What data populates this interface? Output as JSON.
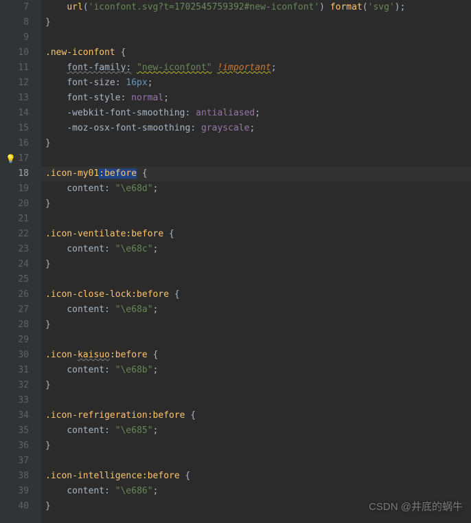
{
  "editor": {
    "startLine": 7,
    "activeLine": 18,
    "bulbLine": 17,
    "lines": [
      {
        "n": 7,
        "indent": 2,
        "tokens": [
          [
            "fn",
            "url"
          ],
          [
            "punc",
            "("
          ],
          [
            "str",
            "'iconfont.svg?t=1702545759392#new-iconfont'"
          ],
          [
            "punc",
            ") "
          ],
          [
            "fn",
            "format"
          ],
          [
            "punc",
            "("
          ],
          [
            "str",
            "'svg'"
          ],
          [
            "punc",
            ");"
          ]
        ]
      },
      {
        "n": 8,
        "indent": 1,
        "tokens": [
          [
            "brace",
            "}"
          ]
        ]
      },
      {
        "n": 9,
        "indent": 0,
        "tokens": []
      },
      {
        "n": 10,
        "indent": 1,
        "tokens": [
          [
            "sel",
            ".new-iconfont "
          ],
          [
            "brace",
            "{"
          ]
        ]
      },
      {
        "n": 11,
        "indent": 2,
        "tokens": [
          [
            "prop wavy",
            "font-family:"
          ],
          [
            "pl",
            " "
          ],
          [
            "str wavy2",
            "\"new-iconfont\""
          ],
          [
            "pl",
            " "
          ],
          [
            "imp wavy2",
            "!important"
          ],
          [
            "punc",
            ";"
          ]
        ]
      },
      {
        "n": 12,
        "indent": 2,
        "tokens": [
          [
            "prop",
            "font-size: "
          ],
          [
            "num",
            "16px"
          ],
          [
            "punc",
            ";"
          ]
        ]
      },
      {
        "n": 13,
        "indent": 2,
        "tokens": [
          [
            "prop",
            "font-style: "
          ],
          [
            "val",
            "normal"
          ],
          [
            "punc",
            ";"
          ]
        ]
      },
      {
        "n": 14,
        "indent": 2,
        "tokens": [
          [
            "prop",
            "-webkit-font-smoothing: "
          ],
          [
            "val",
            "antialiased"
          ],
          [
            "punc",
            ";"
          ]
        ]
      },
      {
        "n": 15,
        "indent": 2,
        "tokens": [
          [
            "prop",
            "-moz-osx-font-smoothing: "
          ],
          [
            "val",
            "grayscale"
          ],
          [
            "punc",
            ";"
          ]
        ]
      },
      {
        "n": 16,
        "indent": 1,
        "tokens": [
          [
            "brace",
            "}"
          ]
        ]
      },
      {
        "n": 17,
        "indent": 0,
        "tokens": []
      },
      {
        "n": 18,
        "indent": 1,
        "tokens": [
          [
            "sel",
            ".icon-my01"
          ],
          [
            "sel highlight",
            ":before"
          ],
          [
            "sel",
            " "
          ],
          [
            "brace",
            "{"
          ]
        ]
      },
      {
        "n": 19,
        "indent": 2,
        "tokens": [
          [
            "prop",
            "content: "
          ],
          [
            "str",
            "\"\\e68d\""
          ],
          [
            "punc",
            ";"
          ]
        ]
      },
      {
        "n": 20,
        "indent": 1,
        "tokens": [
          [
            "brace",
            "}"
          ]
        ]
      },
      {
        "n": 21,
        "indent": 0,
        "tokens": []
      },
      {
        "n": 22,
        "indent": 1,
        "tokens": [
          [
            "sel",
            ".icon-ventilate"
          ],
          [
            "sel",
            ":before "
          ],
          [
            "brace",
            "{"
          ]
        ]
      },
      {
        "n": 23,
        "indent": 2,
        "tokens": [
          [
            "prop",
            "content: "
          ],
          [
            "str",
            "\"\\e68c\""
          ],
          [
            "punc",
            ";"
          ]
        ]
      },
      {
        "n": 24,
        "indent": 1,
        "tokens": [
          [
            "brace",
            "}"
          ]
        ]
      },
      {
        "n": 25,
        "indent": 0,
        "tokens": []
      },
      {
        "n": 26,
        "indent": 1,
        "tokens": [
          [
            "sel",
            ".icon-close-lock"
          ],
          [
            "sel",
            ":before "
          ],
          [
            "brace",
            "{"
          ]
        ]
      },
      {
        "n": 27,
        "indent": 2,
        "tokens": [
          [
            "prop",
            "content: "
          ],
          [
            "str",
            "\"\\e68a\""
          ],
          [
            "punc",
            ";"
          ]
        ]
      },
      {
        "n": 28,
        "indent": 1,
        "tokens": [
          [
            "brace",
            "}"
          ]
        ]
      },
      {
        "n": 29,
        "indent": 0,
        "tokens": []
      },
      {
        "n": 30,
        "indent": 1,
        "tokens": [
          [
            "sel",
            ".icon-"
          ],
          [
            "sel wavy",
            "kaisuo"
          ],
          [
            "sel",
            ":before "
          ],
          [
            "brace",
            "{"
          ]
        ]
      },
      {
        "n": 31,
        "indent": 2,
        "tokens": [
          [
            "prop",
            "content: "
          ],
          [
            "str",
            "\"\\e68b\""
          ],
          [
            "punc",
            ";"
          ]
        ]
      },
      {
        "n": 32,
        "indent": 1,
        "tokens": [
          [
            "brace",
            "}"
          ]
        ]
      },
      {
        "n": 33,
        "indent": 0,
        "tokens": []
      },
      {
        "n": 34,
        "indent": 1,
        "tokens": [
          [
            "sel",
            ".icon-refrigeration"
          ],
          [
            "sel",
            ":before "
          ],
          [
            "brace",
            "{"
          ]
        ]
      },
      {
        "n": 35,
        "indent": 2,
        "tokens": [
          [
            "prop",
            "content: "
          ],
          [
            "str",
            "\"\\e685\""
          ],
          [
            "punc",
            ";"
          ]
        ]
      },
      {
        "n": 36,
        "indent": 1,
        "tokens": [
          [
            "brace",
            "}"
          ]
        ]
      },
      {
        "n": 37,
        "indent": 0,
        "tokens": []
      },
      {
        "n": 38,
        "indent": 1,
        "tokens": [
          [
            "sel",
            ".icon-intelligence"
          ],
          [
            "sel",
            ":before "
          ],
          [
            "brace",
            "{"
          ]
        ]
      },
      {
        "n": 39,
        "indent": 2,
        "tokens": [
          [
            "prop",
            "content: "
          ],
          [
            "str",
            "\"\\e686\""
          ],
          [
            "punc",
            ";"
          ]
        ]
      },
      {
        "n": 40,
        "indent": 1,
        "tokens": [
          [
            "brace",
            "}"
          ]
        ]
      }
    ]
  },
  "watermark": "CSDN @井底的蜗牛"
}
